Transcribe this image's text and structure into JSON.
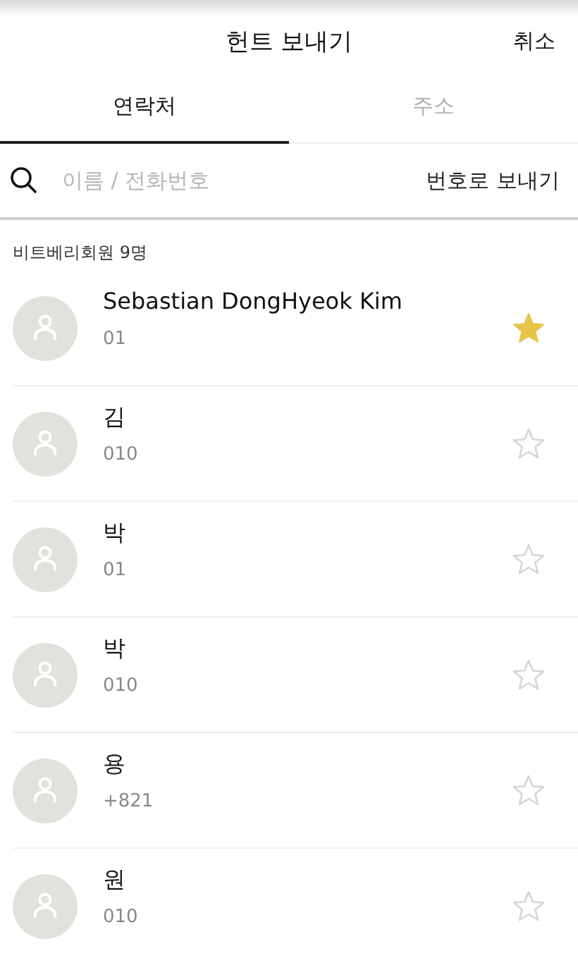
{
  "header": {
    "title": "헌트 보내기",
    "cancel": "취소"
  },
  "tabs": [
    {
      "label": "연락처",
      "selected": true
    },
    {
      "label": "주소",
      "selected": false
    }
  ],
  "search": {
    "placeholder": "이름 / 전화번호",
    "action": "번호로 보내기"
  },
  "section": {
    "title": "비트베리회원 9명"
  },
  "contacts": [
    {
      "name": "Sebastian DongHyeok Kim",
      "phone": "01",
      "favorite": true
    },
    {
      "name": "김",
      "phone": "010",
      "favorite": false
    },
    {
      "name": "박",
      "phone": "01",
      "favorite": false
    },
    {
      "name": "박",
      "phone": "010",
      "favorite": false
    },
    {
      "name": "용",
      "phone": "+821",
      "favorite": false
    },
    {
      "name": "원",
      "phone": "010",
      "favorite": false
    }
  ]
}
